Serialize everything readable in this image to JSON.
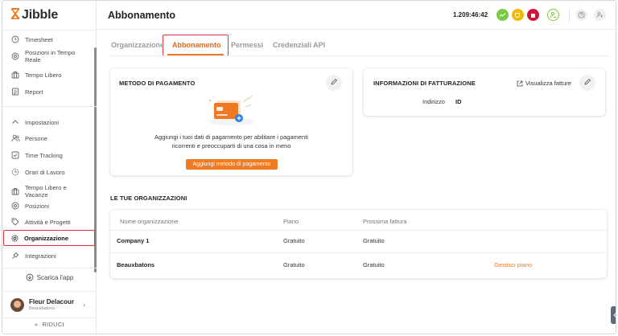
{
  "brand": {
    "name": "Jibble",
    "accent": "#f07a22",
    "highlight": "#d9363e"
  },
  "sidebar": {
    "items": [
      {
        "label": "Timesheet",
        "icon": "clock-icon"
      },
      {
        "label": "Posizioni in Tempo Reale",
        "icon": "location-icon"
      },
      {
        "label": "Tempo Libero",
        "icon": "suitcase-icon"
      },
      {
        "label": "Report",
        "icon": "report-icon"
      },
      {
        "label": "Impostazioni",
        "icon": "chevron-up-icon"
      },
      {
        "label": "Persone",
        "icon": "people-icon"
      },
      {
        "label": "Time Tracking",
        "icon": "time-tracking-icon"
      },
      {
        "label": "Orari di Lavoro",
        "icon": "work-schedule-icon"
      },
      {
        "label": "Tempo Libero e Vacanze",
        "icon": "suitcase-icon"
      },
      {
        "label": "Posizioni",
        "icon": "location-icon"
      },
      {
        "label": "Attività e Progetti",
        "icon": "tag-icon"
      },
      {
        "label": "Organizzazione",
        "icon": "gear-icon"
      },
      {
        "label": "Integrazioni",
        "icon": "plug-icon"
      }
    ],
    "download_label": "Scarica l'app",
    "user": {
      "name": "Fleur Delacour",
      "org": "Beauxbatons"
    },
    "collapse_label": "RIDUCI"
  },
  "header": {
    "title": "Abbonamento",
    "timer": "1.209:46:42",
    "status_colors": [
      "#7ac943",
      "#f5b800",
      "#d4123a"
    ]
  },
  "tabs": [
    {
      "label": "Organizzazione",
      "active": false
    },
    {
      "label": "Abbonamento",
      "active": true
    },
    {
      "label": "Permessi",
      "active": false
    },
    {
      "label": "Credenziali API",
      "active": false
    }
  ],
  "payment": {
    "title": "METODO DI PAGAMENTO",
    "description_line1": "Aggiungi i tuoi dati di pagamento per abilitare i pagamenti",
    "description_line2": "ricorrenti e preoccuparti di una cosa in meno",
    "button_label": "Aggiungi metodo di pagamento"
  },
  "billing": {
    "title": "INFORMAZIONI DI FATTURAZIONE",
    "view_invoices_label": "Visualizza fatture",
    "address_label": "Indirizzo",
    "id_label": "ID"
  },
  "organizations": {
    "title": "LE TUE ORGANIZZAZIONI",
    "columns": [
      "Nome organizzazione",
      "Piano",
      "Prossima fattura"
    ],
    "rows": [
      {
        "name": "Company 1",
        "plan": "Gratuito",
        "next_invoice": "Gratuito",
        "action": ""
      },
      {
        "name": "Beauxbatons",
        "plan": "Gratuito",
        "next_invoice": "Gratuito",
        "action": "Gestisci piano"
      }
    ]
  }
}
